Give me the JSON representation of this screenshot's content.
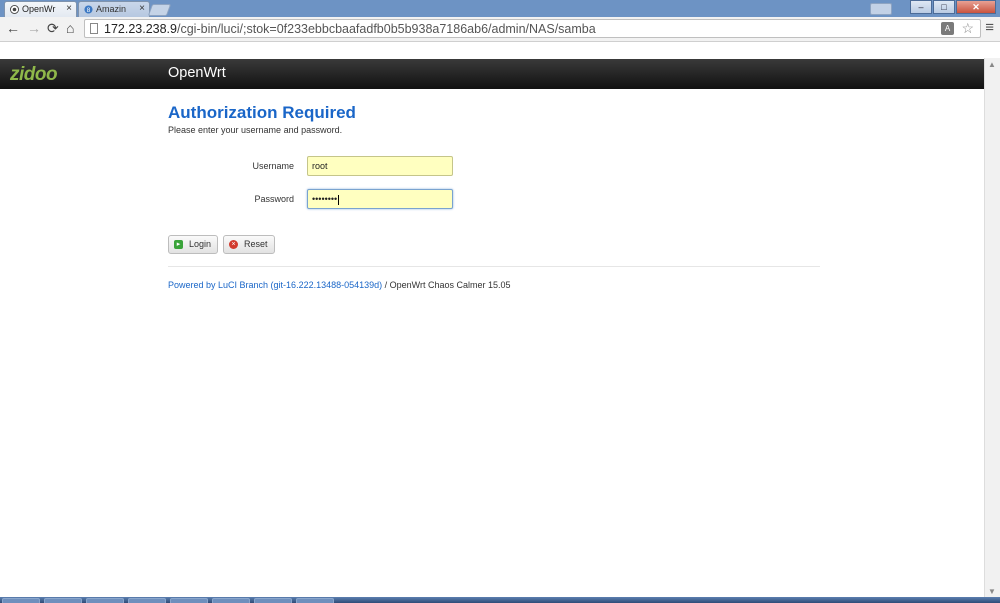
{
  "browser": {
    "tabs": [
      {
        "label": "OpenWr",
        "close": "×",
        "favicon": "openwrt-favicon"
      },
      {
        "label": "Amazin",
        "close": "×",
        "favicon": "amazon-favicon"
      }
    ],
    "url_host": "172.23.238.9",
    "url_path": "/cgi-bin/luci/;stok=0f233ebbcbaafadfb0b5b938a7186ab6/admin/NAS/samba",
    "window_controls": {
      "minimize": "–",
      "maximize": "□",
      "close": "✕"
    }
  },
  "header": {
    "logo": "zidoo",
    "brand": "OpenWrt"
  },
  "auth": {
    "title": "Authorization Required",
    "subtitle": "Please enter your username and password.",
    "username_label": "Username",
    "username_value": "root",
    "password_label": "Password",
    "password_value": "••••••••",
    "login_label": "Login",
    "reset_label": "Reset"
  },
  "footer": {
    "link": "Powered by LuCI Branch (git-16.222.13488-054139d)",
    "text": " / OpenWrt Chaos Calmer 15.05"
  },
  "colors": {
    "accent": "#1a66c8",
    "header_bg": "#222222",
    "input_bg": "#ffffc0"
  }
}
